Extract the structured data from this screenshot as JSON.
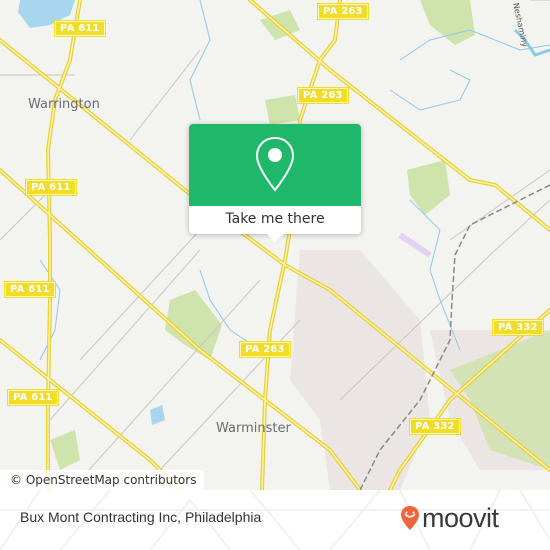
{
  "map": {
    "road_labels": [
      {
        "id": "pa611-top",
        "text": "PA 611"
      },
      {
        "id": "pa263-top",
        "text": "PA 263"
      },
      {
        "id": "pa263-mid",
        "text": "PA 263"
      },
      {
        "id": "pa611-left-upper",
        "text": "PA 611"
      },
      {
        "id": "pa611-left-mid",
        "text": "PA 611"
      },
      {
        "id": "pa611-left-lower",
        "text": "PA 611"
      },
      {
        "id": "pa263-south",
        "text": "PA 263"
      },
      {
        "id": "pa332-east",
        "text": "PA 332"
      },
      {
        "id": "pa332-south",
        "text": "PA 332"
      }
    ],
    "place_labels": {
      "warrington": "Warrington",
      "warminster": "Warminster"
    },
    "river_label": "Neshaminy",
    "attribution": "© OpenStreetMap contributors",
    "colors": {
      "background": "#f3f3ef",
      "highway": "#f2dc2a",
      "water": "#a8d6ee",
      "park": "#cfe3ad",
      "urban": "#ebe5e3"
    }
  },
  "popup": {
    "icon": "location-pin-icon",
    "cta_label": "Take me there",
    "accent_color": "#1fb86b"
  },
  "footer": {
    "location_title": "Bux Mont Contracting Inc, Philadelphia",
    "brand": "moovit",
    "brand_color": "#f0643c"
  }
}
